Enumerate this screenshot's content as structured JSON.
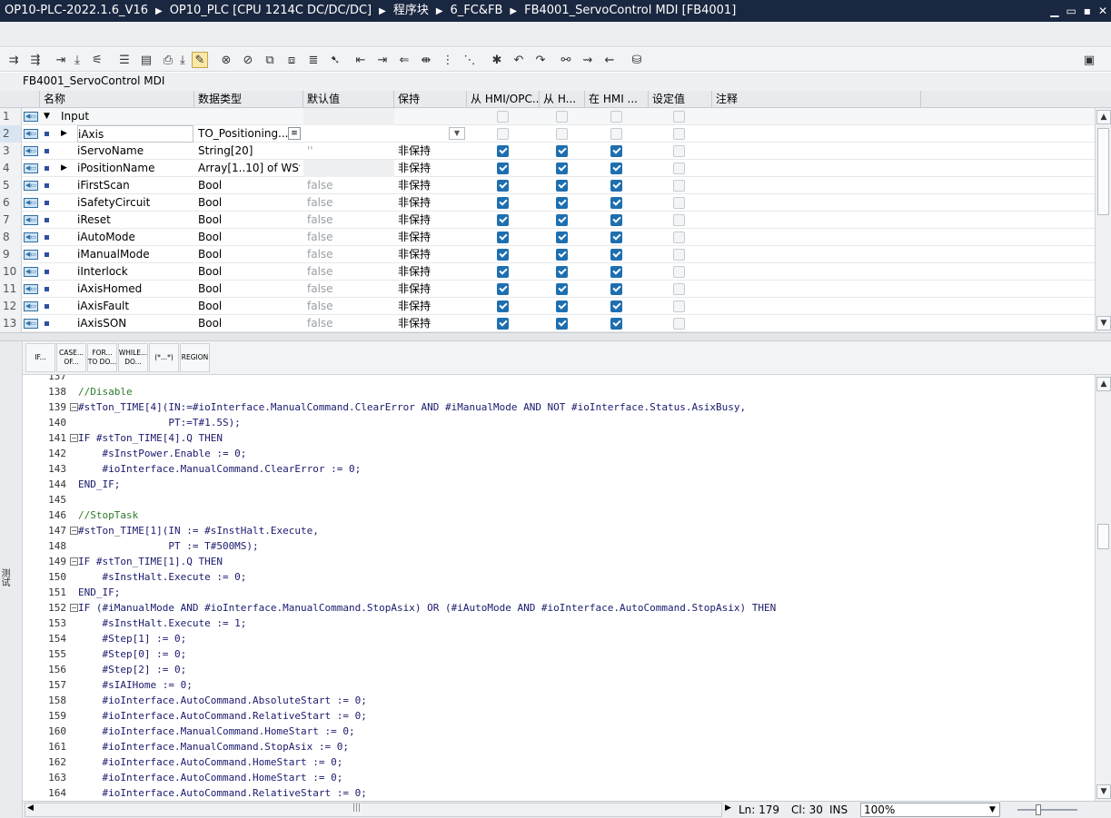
{
  "titlebar": {
    "crumbs": [
      "OP10-PLC-2022.1.6_V16",
      "OP10_PLC [CPU 1214C DC/DC/DC]",
      "程序块",
      "6_FC&FB",
      "FB4001_ServoControl MDI [FB4001]"
    ],
    "separator": "▶",
    "min": "▁",
    "restore": "▭",
    "tile": "▪",
    "close": "✕"
  },
  "block_title": "FB4001_ServoControl MDI",
  "interface": {
    "columns": [
      "名称",
      "数据类型",
      "默认值",
      "保持",
      "从 HMI/OPC...",
      "从 H...",
      "在 HMI ...",
      "设定值",
      "注释"
    ],
    "rows": [
      {
        "num": "1",
        "expand": "▼",
        "name": "Input",
        "type": "",
        "default": "",
        "retain": "",
        "hmi1": "dis",
        "hmi2": "dis",
        "hmi3": "dis",
        "setpoint": "dis",
        "section": true
      },
      {
        "num": "2",
        "expand": "▶",
        "name": "iAxis",
        "type": "TO_Positioning...",
        "default": "",
        "retain": "",
        "hmi1": "dis",
        "hmi2": "dis",
        "hmi3": "dis",
        "setpoint": "dis",
        "selected": true
      },
      {
        "num": "3",
        "expand": "",
        "name": "iServoName",
        "type": "String[20]",
        "default": "''",
        "retain": "非保持",
        "hmi1": "on",
        "hmi2": "on",
        "hmi3": "on",
        "setpoint": "dis"
      },
      {
        "num": "4",
        "expand": "▶",
        "name": "iPositionName",
        "type": "Array[1..10] of WSt...",
        "default": "",
        "retain": "非保持",
        "hmi1": "on",
        "hmi2": "on",
        "hmi3": "on",
        "setpoint": "dis"
      },
      {
        "num": "5",
        "expand": "",
        "name": "iFirstScan",
        "type": "Bool",
        "default": "false",
        "retain": "非保持",
        "hmi1": "on",
        "hmi2": "on",
        "hmi3": "on",
        "setpoint": "dis"
      },
      {
        "num": "6",
        "expand": "",
        "name": "iSafetyCircuit",
        "type": "Bool",
        "default": "false",
        "retain": "非保持",
        "hmi1": "on",
        "hmi2": "on",
        "hmi3": "on",
        "setpoint": "dis"
      },
      {
        "num": "7",
        "expand": "",
        "name": "iReset",
        "type": "Bool",
        "default": "false",
        "retain": "非保持",
        "hmi1": "on",
        "hmi2": "on",
        "hmi3": "on",
        "setpoint": "dis"
      },
      {
        "num": "8",
        "expand": "",
        "name": "iAutoMode",
        "type": "Bool",
        "default": "false",
        "retain": "非保持",
        "hmi1": "on",
        "hmi2": "on",
        "hmi3": "on",
        "setpoint": "dis"
      },
      {
        "num": "9",
        "expand": "",
        "name": "iManualMode",
        "type": "Bool",
        "default": "false",
        "retain": "非保持",
        "hmi1": "on",
        "hmi2": "on",
        "hmi3": "on",
        "setpoint": "dis"
      },
      {
        "num": "10",
        "expand": "",
        "name": "iInterlock",
        "type": "Bool",
        "default": "false",
        "retain": "非保持",
        "hmi1": "on",
        "hmi2": "on",
        "hmi3": "on",
        "setpoint": "dis"
      },
      {
        "num": "11",
        "expand": "",
        "name": "iAxisHomed",
        "type": "Bool",
        "default": "false",
        "retain": "非保持",
        "hmi1": "on",
        "hmi2": "on",
        "hmi3": "on",
        "setpoint": "dis"
      },
      {
        "num": "12",
        "expand": "",
        "name": "iAxisFault",
        "type": "Bool",
        "default": "false",
        "retain": "非保持",
        "hmi1": "on",
        "hmi2": "on",
        "hmi3": "on",
        "setpoint": "dis"
      },
      {
        "num": "13",
        "expand": "",
        "name": "iAxisSON",
        "type": "Bool",
        "default": "false",
        "retain": "非保持",
        "hmi1": "on",
        "hmi2": "on",
        "hmi3": "on",
        "setpoint": "dis"
      }
    ]
  },
  "snippets": [
    "IF...",
    "CASE...\nOF...",
    "FOR...\nTO DO...",
    "WHILE...\nDO...",
    "(*...*)",
    "REGION"
  ],
  "side_label": "测试",
  "code": [
    {
      "n": "137",
      "fold": "",
      "text": ""
    },
    {
      "n": "138",
      "fold": "",
      "text": "//Disable",
      "indent": 0,
      "cm": true
    },
    {
      "n": "139",
      "fold": "−",
      "text": "#stTon_TIME[4](IN:=#ioInterface.ManualCommand.ClearError AND #iManualMode AND NOT #ioInterface.Status.AsixBusy,"
    },
    {
      "n": "140",
      "fold": "",
      "text": "               PT:=T#1.5S);"
    },
    {
      "n": "141",
      "fold": "−",
      "text": "IF #stTon_TIME[4].Q THEN"
    },
    {
      "n": "142",
      "fold": "",
      "text": "    #sInstPower.Enable := 0;"
    },
    {
      "n": "143",
      "fold": "",
      "text": "    #ioInterface.ManualCommand.ClearError := 0;"
    },
    {
      "n": "144",
      "fold": "",
      "text": "END_IF;"
    },
    {
      "n": "145",
      "fold": "",
      "text": ""
    },
    {
      "n": "146",
      "fold": "",
      "text": "//StopTask",
      "cm": true
    },
    {
      "n": "147",
      "fold": "−",
      "text": "#stTon_TIME[1](IN := #sInstHalt.Execute,"
    },
    {
      "n": "148",
      "fold": "",
      "text": "               PT := T#500MS);"
    },
    {
      "n": "149",
      "fold": "−",
      "text": "IF #stTon_TIME[1].Q THEN"
    },
    {
      "n": "150",
      "fold": "",
      "text": "    #sInstHalt.Execute := 0;"
    },
    {
      "n": "151",
      "fold": "",
      "text": "END_IF;"
    },
    {
      "n": "152",
      "fold": "−",
      "text": "IF (#iManualMode AND #ioInterface.ManualCommand.StopAsix) OR (#iAutoMode AND #ioInterface.AutoCommand.StopAsix) THEN"
    },
    {
      "n": "153",
      "fold": "",
      "text": "    #sInstHalt.Execute := 1;"
    },
    {
      "n": "154",
      "fold": "",
      "text": "    #Step[1] := 0;"
    },
    {
      "n": "155",
      "fold": "",
      "text": "    #Step[0] := 0;"
    },
    {
      "n": "156",
      "fold": "",
      "text": "    #Step[2] := 0;"
    },
    {
      "n": "157",
      "fold": "",
      "text": "    #sIAIHome := 0;"
    },
    {
      "n": "158",
      "fold": "",
      "text": "    #ioInterface.AutoCommand.AbsoluteStart := 0;"
    },
    {
      "n": "159",
      "fold": "",
      "text": "    #ioInterface.AutoCommand.RelativeStart := 0;"
    },
    {
      "n": "160",
      "fold": "",
      "text": "    #ioInterface.ManualCommand.HomeStart := 0;"
    },
    {
      "n": "161",
      "fold": "",
      "text": "    #ioInterface.ManualCommand.StopAsix := 0;"
    },
    {
      "n": "162",
      "fold": "",
      "text": "    #ioInterface.AutoCommand.HomeStart := 0;"
    },
    {
      "n": "163",
      "fold": "",
      "text": "    #ioInterface.AutoCommand.HomeStart := 0;"
    },
    {
      "n": "164",
      "fold": "",
      "text": "    #ioInterface.AutoCommand.RelativeStart := 0;"
    }
  ],
  "status": {
    "ln": "Ln: 179",
    "cl": "Cl: 30",
    "mode": "INS",
    "zoom": "100%"
  }
}
